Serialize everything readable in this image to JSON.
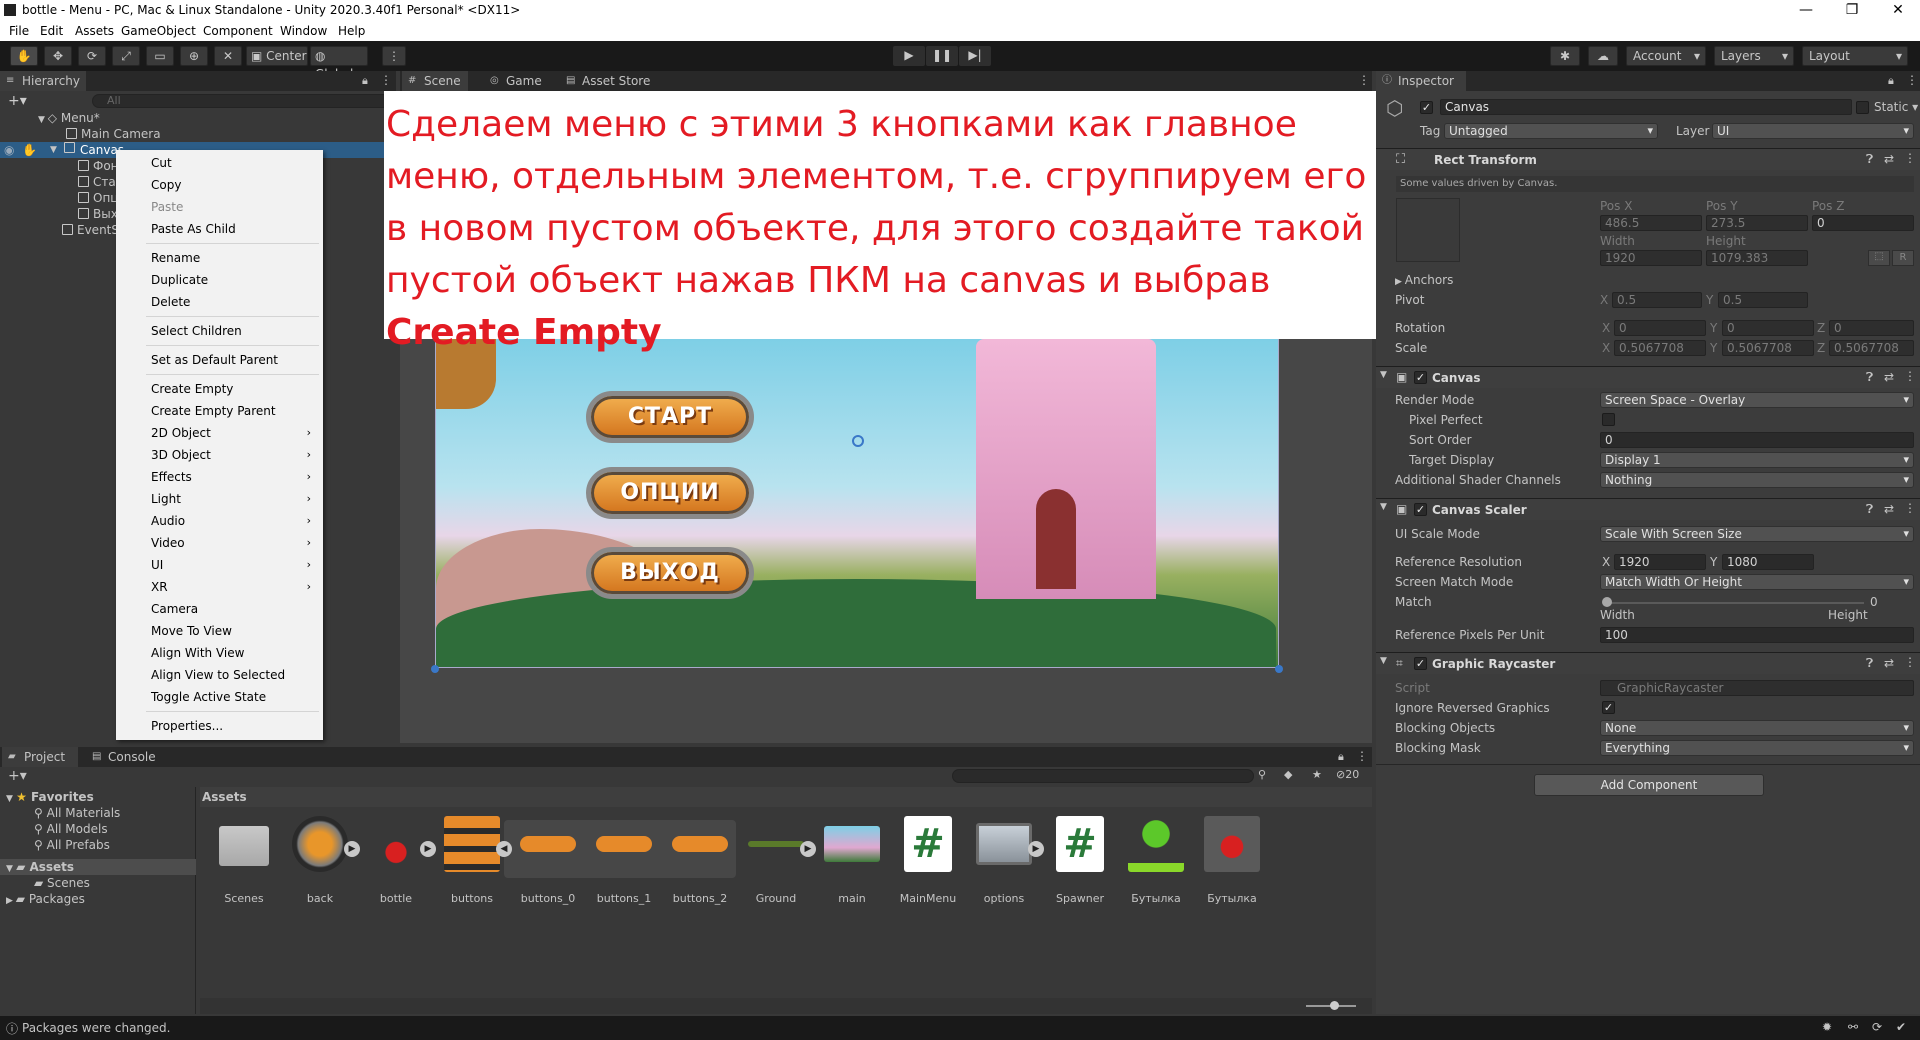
{
  "window": {
    "title": "bottle - Menu - PC, Mac & Linux Standalone - Unity 2020.3.40f1 Personal* <DX11>",
    "controls": [
      "—",
      "❐",
      "✕"
    ]
  },
  "menubar": [
    "File",
    "Edit",
    "Assets",
    "GameObject",
    "Component",
    "Window",
    "Help"
  ],
  "toolbar": {
    "pivot": "Center",
    "space": "Global",
    "account": "Account",
    "layers": "Layers",
    "layout": "Layout"
  },
  "hierarchy": {
    "tab": "Hierarchy",
    "search_placeholder": "All",
    "items": [
      {
        "label": "Menu*"
      },
      {
        "label": "Main Camera"
      },
      {
        "label": "Canvas"
      },
      {
        "label": "Фон"
      },
      {
        "label": "Ста"
      },
      {
        "label": "Опц"
      },
      {
        "label": "Вых"
      },
      {
        "label": "EventS"
      }
    ]
  },
  "context_menu": {
    "items": [
      {
        "label": "Cut"
      },
      {
        "label": "Copy"
      },
      {
        "label": "Paste"
      },
      {
        "label": "Paste As Child"
      },
      {
        "label": "Rename"
      },
      {
        "label": "Duplicate"
      },
      {
        "label": "Delete"
      },
      {
        "label": "Select Children"
      },
      {
        "label": "Set as Default Parent"
      },
      {
        "label": "Create Empty"
      },
      {
        "label": "Create Empty Parent"
      },
      {
        "label": "2D Object"
      },
      {
        "label": "3D Object"
      },
      {
        "label": "Effects"
      },
      {
        "label": "Light"
      },
      {
        "label": "Audio"
      },
      {
        "label": "Video"
      },
      {
        "label": "UI"
      },
      {
        "label": "XR"
      },
      {
        "label": "Camera"
      },
      {
        "label": "Move To View"
      },
      {
        "label": "Align With View"
      },
      {
        "label": "Align View to Selected"
      },
      {
        "label": "Toggle Active State"
      },
      {
        "label": "Properties..."
      }
    ],
    "submenu_arrow": "›"
  },
  "scene_tabs": [
    "Scene",
    "Game",
    "Asset Store"
  ],
  "overlay": {
    "text": "Сделаем меню с этими 3 кнопками как главное меню, отдельным элементом, т.е. сгруппируем его в новом пустом объекте, для этого создайте такой пустой объект нажав ПКМ на canvas и выбрав ",
    "bold": "Create Empty",
    "color": "#e31b23"
  },
  "game_buttons": [
    "СТАРТ",
    "ОПЦИИ",
    "ВЫХОД"
  ],
  "inspector": {
    "tab": "Inspector",
    "object_name": "Canvas",
    "static_label": "Static",
    "tag_label": "Tag",
    "tag_value": "Untagged",
    "layer_label": "Layer",
    "layer_value": "UI",
    "rect_transform": {
      "title": "Rect Transform",
      "note": "Some values driven by Canvas.",
      "pos_x_label": "Pos X",
      "pos_y_label": "Pos Y",
      "pos_z_label": "Pos Z",
      "pos_x": "486.5",
      "pos_y": "273.5",
      "pos_z": "0",
      "width_label": "Width",
      "height_label": "Height",
      "width": "1920",
      "height": "1079.383",
      "anchors_label": "Anchors",
      "pivot_label": "Pivot",
      "pivot_x": "0.5",
      "pivot_y": "0.5",
      "rotation_label": "Rotation",
      "rot_x": "0",
      "rot_y": "0",
      "rot_z": "0",
      "scale_label": "Scale",
      "scale_x": "0.5067708",
      "scale_y": "0.5067708",
      "scale_z": "0.5067708",
      "r_button": "R"
    },
    "canvas": {
      "title": "Canvas",
      "render_mode_label": "Render Mode",
      "render_mode": "Screen Space - Overlay",
      "pixel_perfect_label": "Pixel Perfect",
      "sort_order_label": "Sort Order",
      "sort_order": "0",
      "target_display_label": "Target Display",
      "target_display": "Display 1",
      "shader_channels_label": "Additional Shader Channels",
      "shader_channels": "Nothing"
    },
    "canvas_scaler": {
      "title": "Canvas Scaler",
      "ui_scale_mode_label": "UI Scale Mode",
      "ui_scale_mode": "Scale With Screen Size",
      "ref_res_label": "Reference Resolution",
      "ref_x": "1920",
      "ref_y": "1080",
      "match_mode_label": "Screen Match Mode",
      "match_mode": "Match Width Or Height",
      "match_label": "Match",
      "match_value": "0",
      "match_left": "Width",
      "match_right": "Height",
      "ppu_label": "Reference Pixels Per Unit",
      "ppu": "100"
    },
    "graphic_raycaster": {
      "title": "Graphic Raycaster",
      "script_label": "Script",
      "script": "GraphicRaycaster",
      "ignore_reversed_label": "Ignore Reversed Graphics",
      "blocking_objects_label": "Blocking Objects",
      "blocking_objects": "None",
      "blocking_mask_label": "Blocking Mask",
      "blocking_mask": "Everything"
    },
    "add_component": "Add Component"
  },
  "project": {
    "tabs": [
      "Project",
      "Console"
    ],
    "hidden_count": "20",
    "favorites_label": "Favorites",
    "favorites": [
      "All Materials",
      "All Models",
      "All Prefabs"
    ],
    "assets_label": "Assets",
    "assets_children": [
      "Scenes"
    ],
    "packages_label": "Packages",
    "breadcrumb": "Assets",
    "items": [
      "Scenes",
      "back",
      "bottle",
      "buttons",
      "buttons_0",
      "buttons_1",
      "buttons_2",
      "Ground",
      "main",
      "MainMenu",
      "options",
      "Spawner",
      "Бутылка",
      "Бутылка"
    ]
  },
  "status": {
    "message": "Packages were changed."
  }
}
